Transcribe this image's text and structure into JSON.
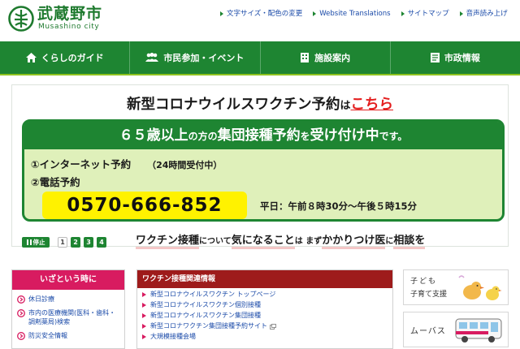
{
  "header": {
    "logo_title": "武蔵野市",
    "logo_sub": "Musashino city",
    "util_links": [
      {
        "label": "文字サイズ・配色の変更"
      },
      {
        "label": "Website Translations"
      },
      {
        "label": "サイトマップ"
      },
      {
        "label": "音声読み上げ"
      }
    ]
  },
  "nav": {
    "items": [
      {
        "label": "くらしのガイド",
        "icon": "home-icon"
      },
      {
        "label": "市民参加・イベント",
        "icon": "people-icon"
      },
      {
        "label": "施設案内",
        "icon": "building-icon"
      },
      {
        "label": "市政情報",
        "icon": "document-icon"
      }
    ]
  },
  "banner": {
    "title_main": "新型コロナウイルスワクチン予約",
    "title_ha": "は",
    "title_link": "こちら",
    "head_a": "６５歳以上",
    "head_b": "の方の",
    "head_c": "集団接種予約",
    "head_d": "を",
    "head_e": "受け付け中",
    "head_f": "です。",
    "line1": "①インターネット予約",
    "line1_note": "（24時間受付中）",
    "line2": "②電話予約",
    "phone": "0570-666-852",
    "hours": "平日：午前８時30分～午後５時15分",
    "foot_a": "ワクチン接種",
    "foot_b": "について",
    "foot_c": "気になること",
    "foot_d": "は まず",
    "foot_e": "かかりつけ医",
    "foot_f": "に",
    "foot_g": "相談を",
    "pause_label": "停止",
    "slides": [
      "1",
      "2",
      "3",
      "4"
    ]
  },
  "emergency": {
    "heading": "いざという時に",
    "items": [
      "休日診療",
      "市内の医療機関(医科・歯科・調剤薬局)検索",
      "防災安全情報"
    ]
  },
  "vaccine": {
    "heading": "ワクチン接種関連情報",
    "items": [
      {
        "label": "新型コロナウイルスワクチン トップページ",
        "ext": false
      },
      {
        "label": "新型コロナウイルスワクチン個別接種",
        "ext": false
      },
      {
        "label": "新型コロナウイルスワクチン集団接種",
        "ext": false
      },
      {
        "label": "新型コロナワクチン集団接種予約サイト",
        "ext": true
      },
      {
        "label": "大規模接種会場",
        "ext": false
      }
    ]
  },
  "side": {
    "kosodate_line1": "子ども",
    "kosodate_line2": "子育て支援",
    "mooba": "ムーバス"
  },
  "colors": {
    "brand_green": "#1e8532",
    "accent_red": "#e41e1e",
    "emergency_pink": "#d81b60",
    "vaccine_maroon": "#9e1b1b",
    "phone_yellow": "#fff200"
  }
}
